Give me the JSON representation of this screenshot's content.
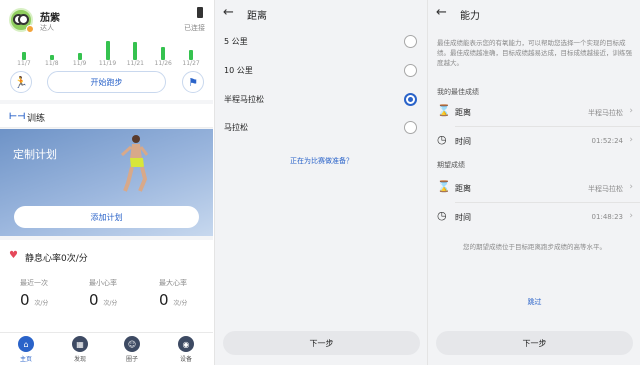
{
  "home": {
    "user_name": "茄紫",
    "user_level": "达人",
    "connection_status": "已连接",
    "activity_dates": [
      "11/7",
      "11/8",
      "11/9",
      "11/19",
      "11/21",
      "11/26",
      "11/27"
    ],
    "activity_levels": [
      0.35,
      0.2,
      0.3,
      0.8,
      0.75,
      0.55,
      0.4
    ],
    "start_run_label": "开始跑步",
    "training_label": "训练",
    "custom_plan_title": "定制计划",
    "add_plan_label": "添加计划",
    "resting_hr_title": "静息心率0次/分",
    "hr_stats": [
      {
        "label": "最近一次",
        "value": "0",
        "unit": "次/分"
      },
      {
        "label": "最小心率",
        "value": "0",
        "unit": "次/分"
      },
      {
        "label": "最大心率",
        "value": "0",
        "unit": "次/分"
      }
    ],
    "tabs": [
      {
        "label": "主页",
        "icon": "home-icon",
        "glyph": "⌂"
      },
      {
        "label": "发现",
        "icon": "grid-icon",
        "glyph": "▦"
      },
      {
        "label": "圈子",
        "icon": "people-icon",
        "glyph": "☺"
      },
      {
        "label": "设备",
        "icon": "watch-icon",
        "glyph": "◉"
      }
    ],
    "accent_color": "#2a63c9",
    "bar_color": "#35c24f"
  },
  "distance": {
    "title": "距离",
    "options": [
      {
        "label": "5 公里",
        "selected": false
      },
      {
        "label": "10 公里",
        "selected": false
      },
      {
        "label": "半程马拉松",
        "selected": true
      },
      {
        "label": "马拉松",
        "selected": false
      }
    ],
    "prep_link": "正在为比赛做准备？",
    "next_label": "下一步"
  },
  "ability": {
    "title": "能力",
    "description": "最佳成绩能表示您的有氧能力，可以帮助您选择一个实现的目标成绩。最佳成绩越准确，目标成绩越易达成，目标成绩越接近，训练强度越大。",
    "best_section": "我的最佳成绩",
    "best": {
      "distance_label": "距离",
      "distance_value": "半程马拉松",
      "time_label": "时间",
      "time_value": "01:52:24"
    },
    "target_section": "期望成绩",
    "target": {
      "distance_label": "距离",
      "distance_value": "半程马拉松",
      "time_label": "时间",
      "time_value": "01:48:23"
    },
    "target_note": "您的期望成绩位于目标距离跑步成绩的高等水平。",
    "skip_label": "跳过",
    "next_label": "下一步"
  }
}
